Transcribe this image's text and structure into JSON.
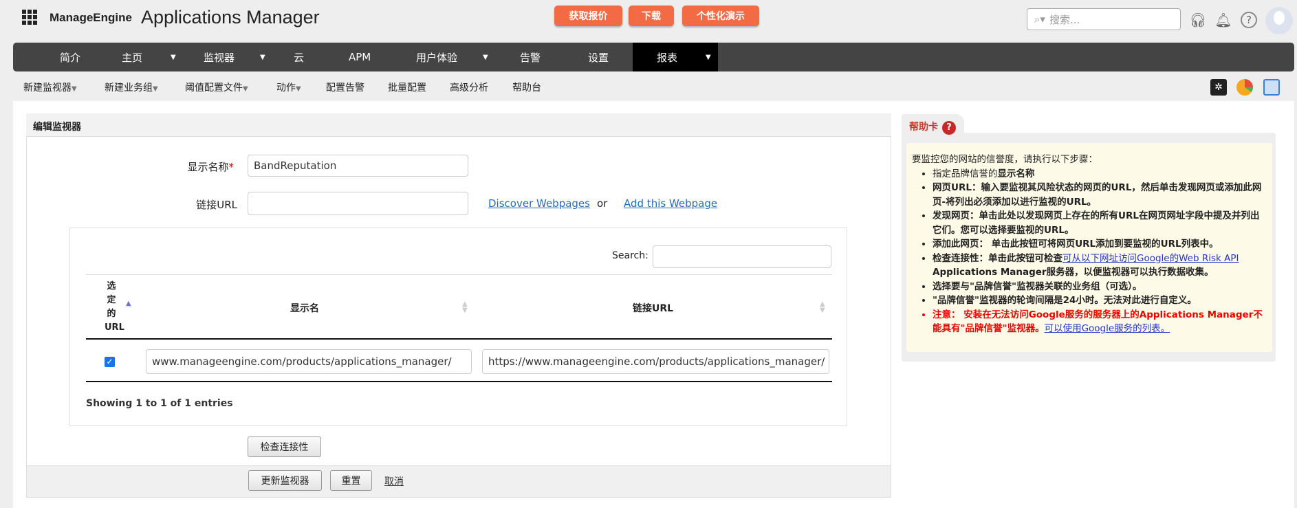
{
  "header": {
    "brand": "ManageEngine",
    "product": "Applications Manager",
    "buttons": [
      "获取报价",
      "下载",
      "个性化演示"
    ],
    "search_placeholder": "搜索..."
  },
  "nav": {
    "items": [
      "简介",
      "主页",
      "监视器",
      "云",
      "APM",
      "用户体验",
      "告警",
      "设置",
      "报表"
    ],
    "active": "报表"
  },
  "subnav": {
    "items": [
      "新建监视器",
      "新建业务组",
      "阈值配置文件",
      "动作",
      "配置告警",
      "批量配置",
      "高级分析",
      "帮助台"
    ]
  },
  "panel": {
    "title": "编辑监视器",
    "display_name_label": "显示名称",
    "display_name_value": "BandReputation",
    "url_label": "链接URL",
    "url_value": "",
    "discover_link": "Discover Webpages",
    "or": "or",
    "add_link": "Add this Webpage",
    "search_label": "Search:",
    "table": {
      "headers": [
        "选定的URL",
        "显示名",
        "链接URL"
      ],
      "header_col1_lines": [
        "选",
        "定",
        "的",
        "URL"
      ],
      "rows": [
        {
          "checked": true,
          "name": "www.manageengine.com/products/applications_manager/",
          "url": "https://www.manageengine.com/products/applications_manager/"
        }
      ]
    },
    "showing": "Showing 1 to 1 of 1 entries",
    "check_button": "检查连接性",
    "update_button": "更新监视器",
    "reset_button": "重置",
    "cancel_link": "取消"
  },
  "help": {
    "tab": "帮助卡",
    "intro": "要监控您的网站的信誉度，请执行以下步骤：",
    "i1a": "指定品牌信誉的",
    "i1b": "显示名称",
    "i2": "网页URL：输入要监视其风险状态的网页的URL，然后单击发现网页或添加此网页-将列出必须添加以进行监视的URL。",
    "i3": "发现网页：单击此处以发现网页上存在的所有URL在网页网址字段中提及并列出它们。您可以选择要监视的URL。",
    "i4": "添加此网页： 单击此按钮可将网页URL添加到要监视的URL列表中。",
    "i5a": "检查连接性：单击此按钮可检查",
    "i5link": "可从以下网址访问Google的Web Risk API ",
    "i5b": "Applications Manager服务器，以便监视器可以执行数据收集。",
    "i6": "选择要与\"品牌信誉\"监视器关联的业务组（可选）。",
    "i7": "\"品牌信誉\"监视器的轮询间隔是24小时。无法对此进行自定义。",
    "i8a": "注意： 安装在无法访问Google服务的服务器上的Applications Manager不能具有\"品牌信誉\"监视器。",
    "i8link": "可以使用Google服务的列表。"
  }
}
